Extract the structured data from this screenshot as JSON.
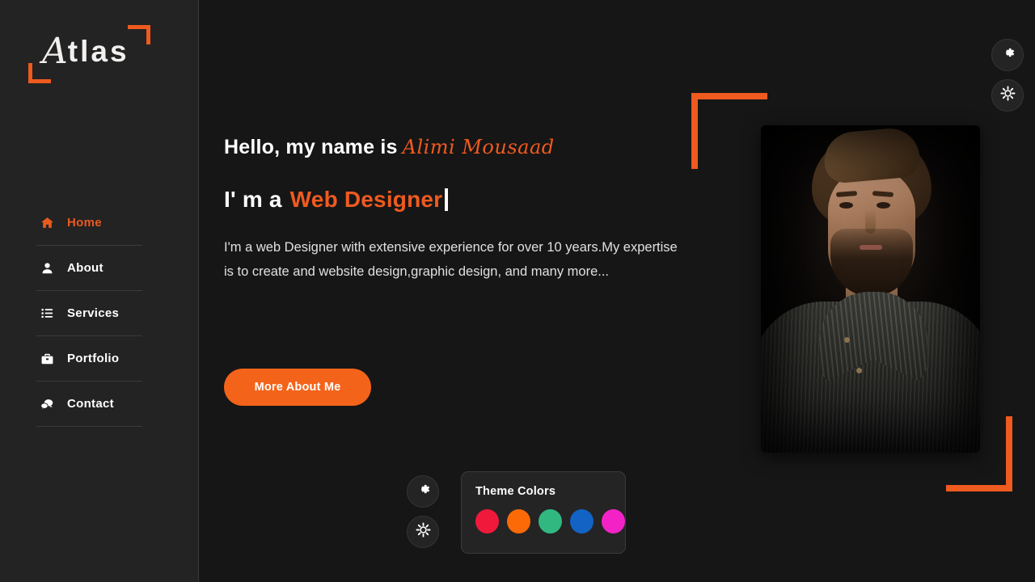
{
  "brand": {
    "logo_text_script": "A",
    "logo_text_rest": "tlas",
    "accent_color": "#ef5a1f"
  },
  "sidebar": {
    "items": [
      {
        "label": "Home",
        "icon": "home-icon",
        "active": true
      },
      {
        "label": "About",
        "icon": "user-icon",
        "active": false
      },
      {
        "label": "Services",
        "icon": "list-icon",
        "active": false
      },
      {
        "label": "Portfolio",
        "icon": "briefcase-icon",
        "active": false
      },
      {
        "label": "Contact",
        "icon": "chat-bubbles-icon",
        "active": false
      }
    ]
  },
  "top_tools": {
    "settings_label": "settings-gear-icon",
    "theme_label": "sun-gear-icon"
  },
  "hero": {
    "greeting": "Hello, my name is",
    "name": "Alimi Mousaad",
    "intro_prefix": "I' m a",
    "role": "Web Designer",
    "bio": "I'm a web Designer with extensive experience for over 10 years.My expertise is to create and website design,graphic design, and many more...",
    "cta_label": "More About Me"
  },
  "theme_panel": {
    "title": "Theme Colors",
    "colors": [
      "#f0193c",
      "#fb6a06",
      "#31b881",
      "#1263c4",
      "#f322c6"
    ]
  }
}
